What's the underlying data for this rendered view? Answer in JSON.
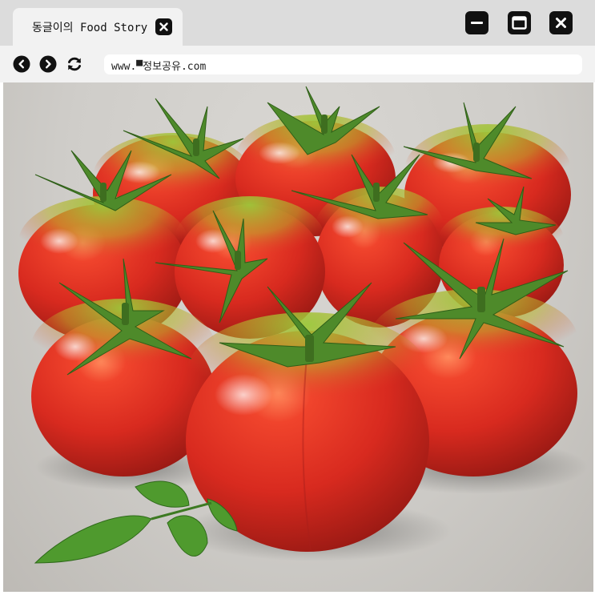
{
  "tab": {
    "title": "동글이의 Food Story",
    "close_icon": "close-icon"
  },
  "window_controls": [
    "minimize-icon",
    "maximize-icon",
    "close-icon"
  ],
  "toolbar": {
    "back_icon": "back-icon",
    "forward_icon": "forward-icon",
    "reload_icon": "reload-icon",
    "url": "www.▀정보공유.com"
  },
  "content": {
    "image": "photo of ripe red-green tomatoes with basil leaves"
  },
  "colors": {
    "titlebar": "#dcdcdc",
    "tab": "#f2f2f2",
    "toolbar": "#f2f2f2",
    "icon": "#111111"
  }
}
